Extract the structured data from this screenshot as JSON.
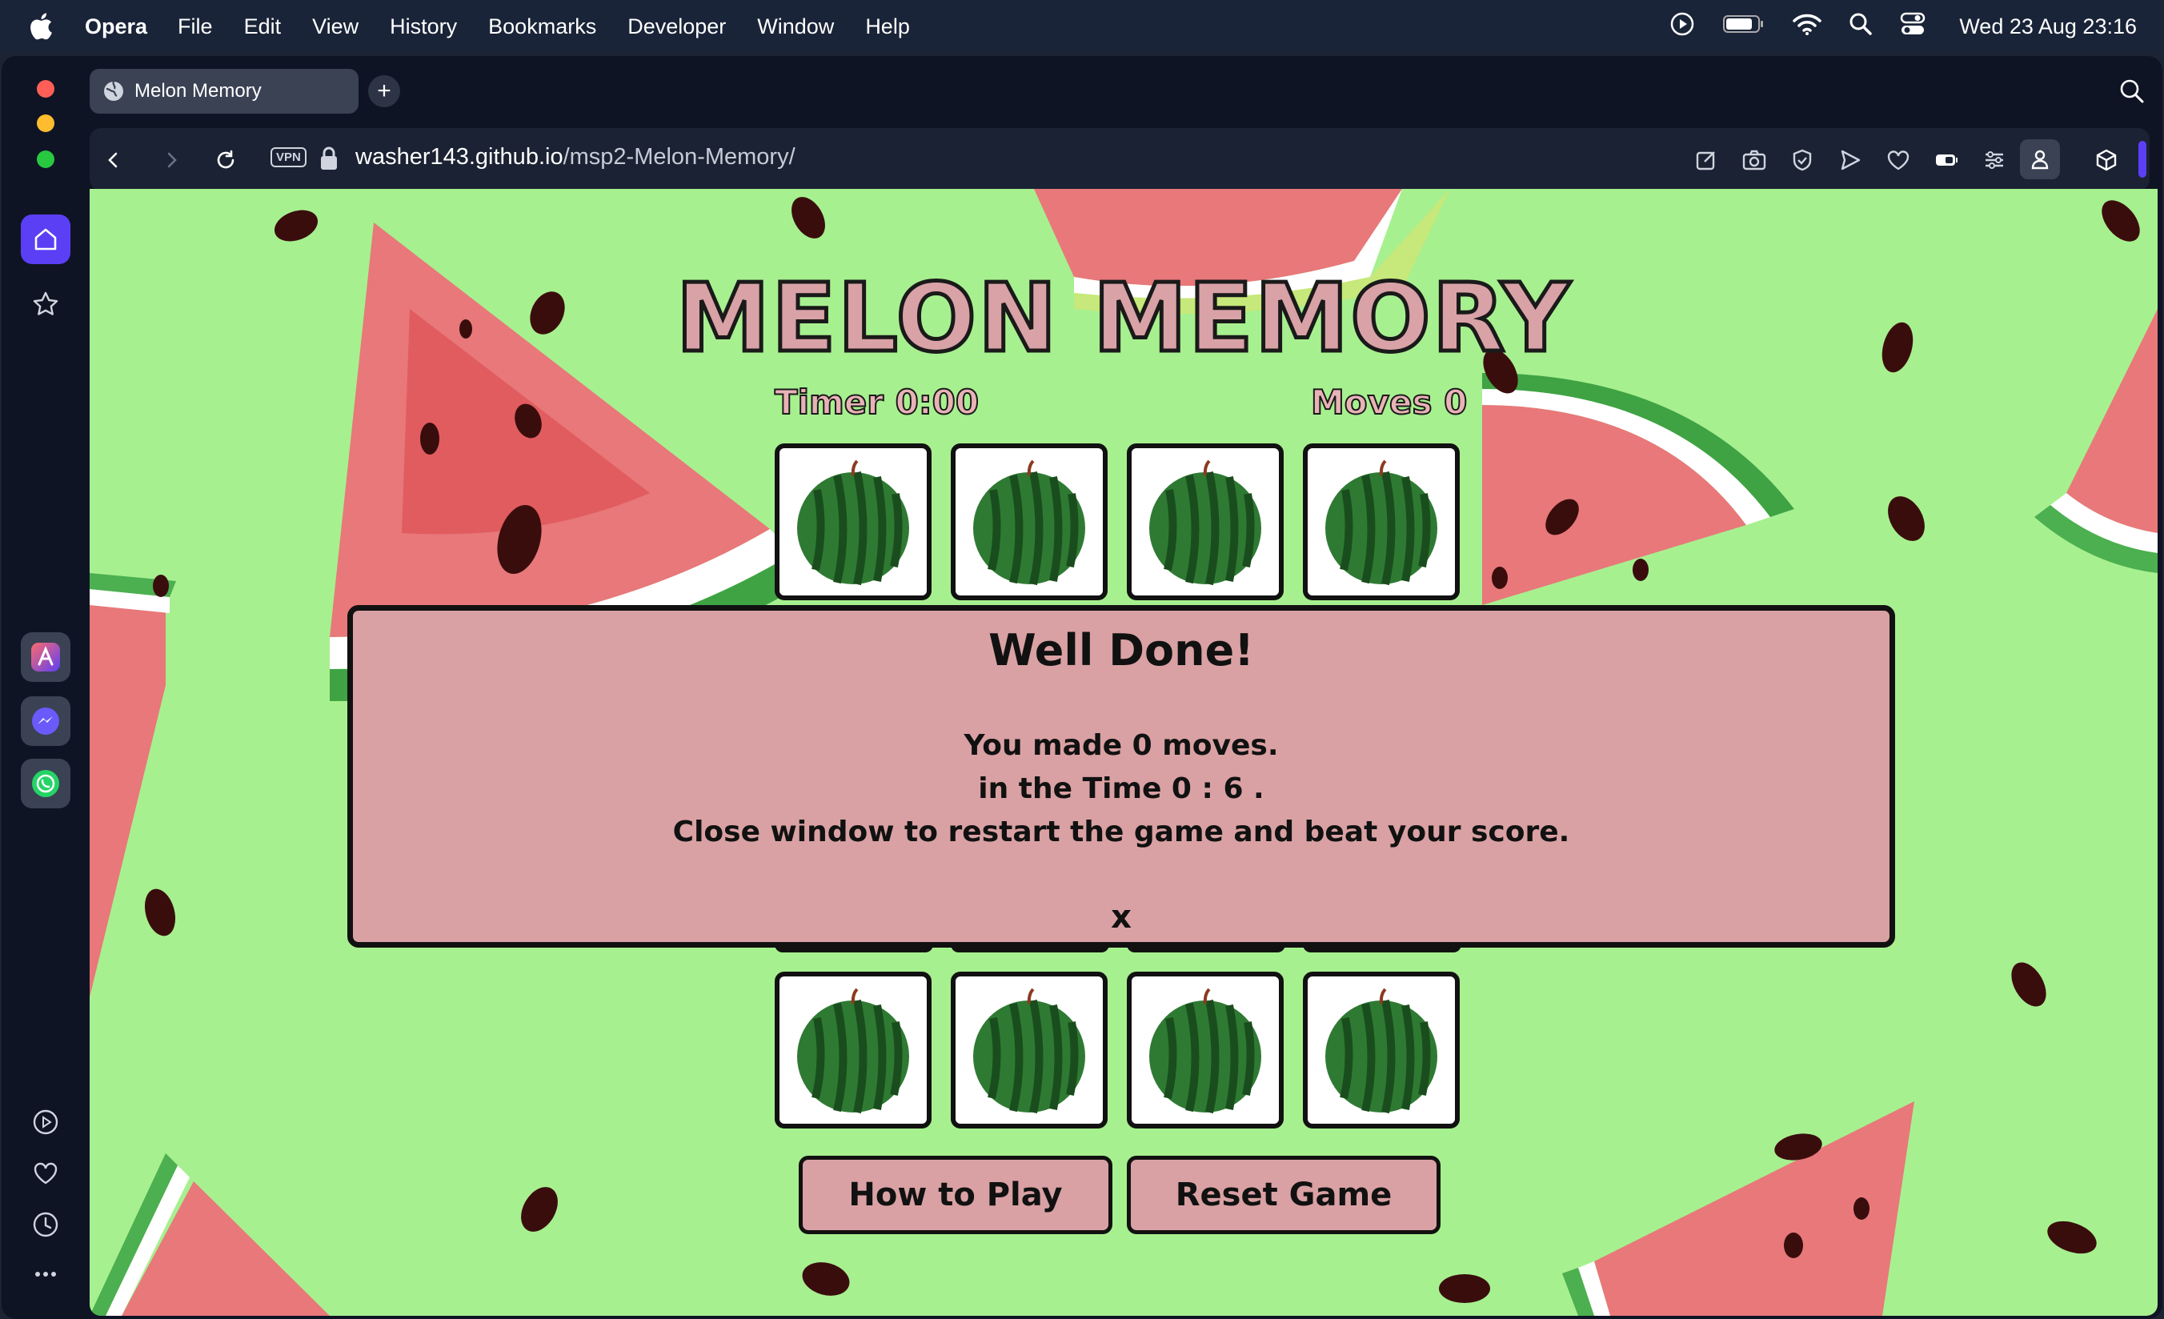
{
  "menubar": {
    "app": "Opera",
    "items": [
      "File",
      "Edit",
      "View",
      "History",
      "Bookmarks",
      "Developer",
      "Window",
      "Help"
    ],
    "clock": "Wed 23 Aug  23:16"
  },
  "browser": {
    "tab_title": "Melon Memory",
    "new_tab": "+",
    "vpn_badge": "VPN",
    "url_host": "washer143.github.io",
    "url_path": "/msp2-Melon-Memory/"
  },
  "game": {
    "title": "MELON MEMORY",
    "timer": "Timer 0:00",
    "moves": "Moves 0",
    "buttons": {
      "how_to_play": "How to Play",
      "reset": "Reset Game"
    }
  },
  "modal": {
    "title": "Well Done!",
    "line1": "You made 0 moves.",
    "line2": "in the Time 0 : 6 .",
    "line3": "Close window to restart the game and beat your score.",
    "close": "x"
  },
  "colors": {
    "page_bg": "#a7f08f",
    "accent_pink": "#d9a1a3",
    "sidebar_active": "#5b3ff5"
  }
}
